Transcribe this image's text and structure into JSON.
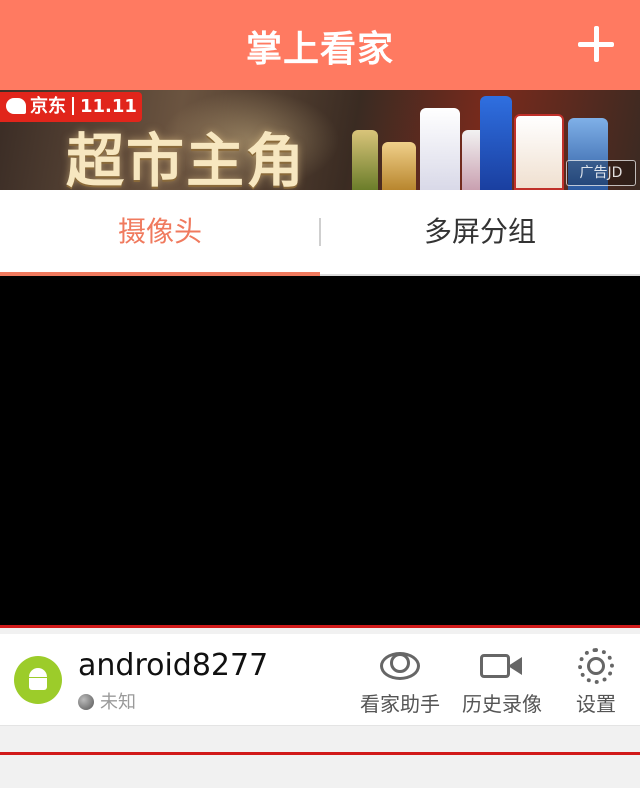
{
  "header": {
    "title": "掌上看家",
    "add_icon": "plus-icon"
  },
  "banner": {
    "brand": "京东",
    "event": "11.11",
    "headline": "超市主角",
    "ad_label": "广告JD",
    "accent_color": "#e1251b"
  },
  "tabs": [
    {
      "label": "摄像头",
      "active": true
    },
    {
      "label": "多屏分组",
      "active": false
    }
  ],
  "device": {
    "name": "android8277",
    "status": "未知",
    "avatar_icon": "android-icon",
    "actions": [
      {
        "label": "看家助手",
        "icon": "eye-icon"
      },
      {
        "label": "历史录像",
        "icon": "video-camera-icon"
      },
      {
        "label": "设置",
        "icon": "gear-icon"
      }
    ]
  },
  "colors": {
    "header_bg": "#ff7a61",
    "active_tab": "#f07a5e",
    "alert_line": "#d11a1a"
  }
}
